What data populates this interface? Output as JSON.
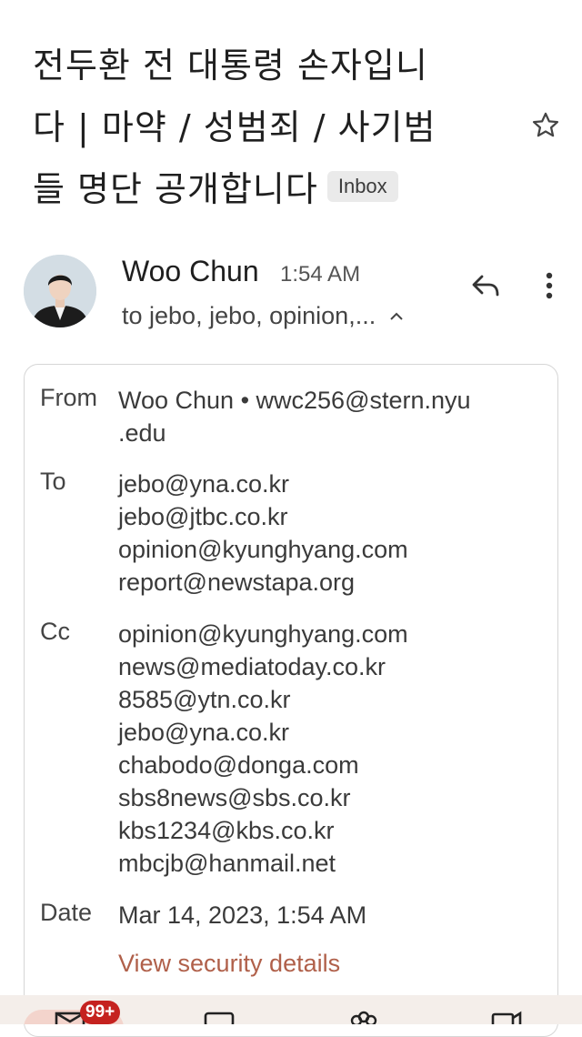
{
  "subject": {
    "lines": [
      "전두환 전 대통령 손자입니",
      "다 | 마약 / 성범죄 / 사기범",
      "들 명단 공개합니다"
    ],
    "label_chip": "Inbox"
  },
  "sender": {
    "name": "Woo Chun",
    "time": "1:54 AM",
    "recipients_summary": "to jebo, jebo, opinion,..."
  },
  "details": {
    "from_label": "From",
    "from_lines": [
      "Woo Chun • wwc256@stern.nyu",
      ".edu"
    ],
    "to_label": "To",
    "to": [
      "jebo@yna.co.kr",
      "jebo@jtbc.co.kr",
      "opinion@kyunghyang.com",
      "report@newstapa.org"
    ],
    "cc_label": "Cc",
    "cc": [
      "opinion@kyunghyang.com",
      "news@mediatoday.co.kr",
      "8585@ytn.co.kr",
      "jebo@yna.co.kr",
      "chabodo@donga.com",
      "sbs8news@sbs.co.kr",
      "kbs1234@kbs.co.kr",
      "mbcjb@hanmail.net"
    ],
    "date_label": "Date",
    "date": "Mar 14, 2023, 1:54 AM",
    "security_link": "View security details"
  },
  "bottom_nav": {
    "mail_badge": "99+"
  },
  "icons": {
    "star": "star-outline-icon",
    "reply": "reply-icon",
    "more": "more-vert-icon",
    "caret": "chevron-up-icon"
  },
  "colors": {
    "link": "#b0604a",
    "badge": "#c5221f",
    "nav_pill": "#f3d4cc"
  }
}
